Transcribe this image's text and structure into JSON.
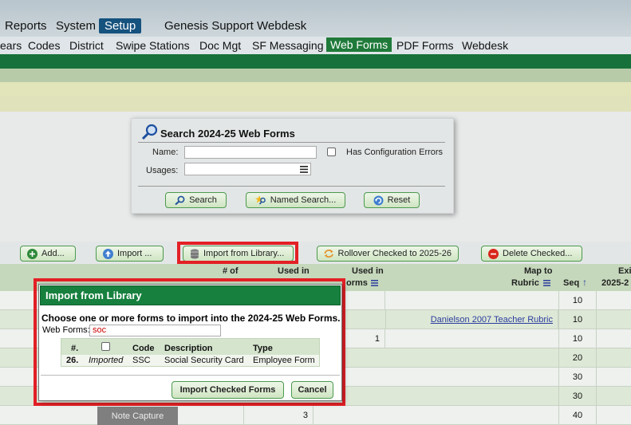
{
  "topnav": {
    "tabs": [
      "Reports",
      "System",
      "Setup",
      "Genesis Support",
      "Webdesk"
    ],
    "active": "Setup"
  },
  "subnav": {
    "items": [
      "ears",
      "Codes",
      "District",
      "Swipe Stations",
      "Doc Mgt",
      "SF Messaging",
      "Web Forms",
      "PDF Forms",
      "Webdesk"
    ],
    "active": "Web Forms"
  },
  "search": {
    "title": "Search 2024-25 Web Forms",
    "name_label": "Name:",
    "usages_label": "Usages:",
    "config_errors_label": "Has Configuration Errors",
    "search_button": "Search",
    "named_search_button": "Named Search...",
    "reset_button": "Reset"
  },
  "toolbar": {
    "add": "Add...",
    "import": "Import ...",
    "import_library": "Import from Library...",
    "rollover": "Rollover Checked to 2025-26",
    "delete": "Delete Checked..."
  },
  "table": {
    "headers": {
      "num_of_l1": "# of",
      "used_in_l1": "Used in",
      "used_in_2_l1": "Used in",
      "used_in_2_l2": "orms",
      "map_to_l1": "Map to",
      "map_to_l2": "Rubric",
      "seq": "Seq",
      "exi_l1": "Exi",
      "exi_l2": "2025-2"
    },
    "rows": [
      {
        "used": "",
        "rubric": "",
        "seq": "10"
      },
      {
        "used": "",
        "rubric": "Danielson 2007 Teacher Rubric",
        "seq": "10"
      },
      {
        "used": "1",
        "rubric": "",
        "seq": "10"
      },
      {
        "used": "",
        "rubric": "",
        "seq": "20"
      },
      {
        "used": "",
        "rubric": "",
        "seq": "30"
      },
      {
        "used": "",
        "rubric": "",
        "seq": "30"
      },
      {
        "used": "3",
        "rubric": "",
        "seq": "40",
        "name": "Note Capture"
      }
    ]
  },
  "modal": {
    "title": "Import from Library",
    "message": "Choose one or more forms to import into the 2024-25 Web Forms.",
    "web_forms_label": "Web Forms:",
    "web_forms_value": "soc",
    "columns": {
      "num": "#.",
      "code": "Code",
      "description": "Description",
      "type": "Type"
    },
    "rows": [
      {
        "num": "26.",
        "status": "Imported",
        "code": "SSC",
        "description": "Social Security Card",
        "type": "Employee Form"
      }
    ],
    "import_button": "Import Checked Forms",
    "cancel_button": "Cancel"
  },
  "colors": {
    "accent_green": "#17803e",
    "highlight_red": "#e32026",
    "setup_tab": "#16527e"
  }
}
